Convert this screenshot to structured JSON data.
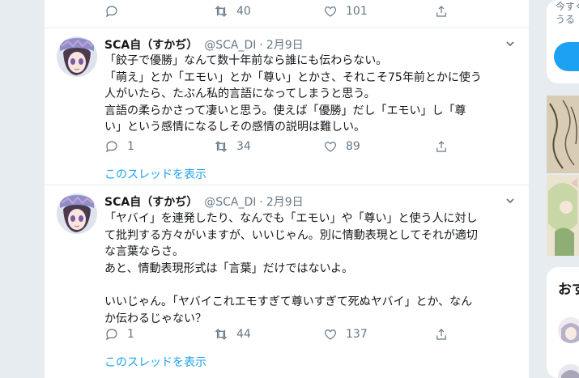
{
  "top_tweet": {
    "reply_count": "",
    "retweet_count": "40",
    "like_count": "101"
  },
  "tweets": [
    {
      "display_name": "SCA自（すかぢ）",
      "handle": "@SCA_DI",
      "separator": "·",
      "date": "2月9日",
      "lines": [
        "「餃子で優勝」なんて数十年前なら誰にも伝わらない。",
        "「萌え」とか「エモい」とか「尊い」とかさ、それこそ75年前とかに使う",
        "人がいたら、たぶん私的言語になってしまうと思う。",
        "言語の柔らかさって凄いと思う。使えば「優勝」だし「エモい」し「尊",
        "い」という感情になるしその感情の説明は難しい。"
      ],
      "reply_count": "1",
      "retweet_count": "34",
      "like_count": "89",
      "thread_link": "このスレッドを表示"
    },
    {
      "display_name": "SCA自（すかぢ）",
      "handle": "@SCA_DI",
      "separator": "·",
      "date": "2月9日",
      "lines": [
        "「ヤバイ」を連発したり、なんでも「エモい」や「尊い」と使う人に対し",
        "て批判する方々がいますが、いいじゃん。別に情動表現としてそれが適切",
        "な言葉ならさ。",
        "あと、情動表現形式は「言葉」だけではないよ。",
        "",
        "いいじゃん。「ヤバイこれエモすぎて尊いすぎて死ぬヤバイ」とか、なん",
        "か伝わるじゃない？"
      ],
      "reply_count": "1",
      "retweet_count": "44",
      "like_count": "137",
      "thread_link": "このスレッドを表示"
    }
  ],
  "sidebar": {
    "trend_lines": [
      "今すぐ",
      "うる"
    ],
    "recommend_title": "おす"
  },
  "icons": {
    "reply": "reply-icon",
    "retweet": "retweet-icon",
    "like": "heart-icon",
    "share": "share-icon",
    "more": "chevron-down-icon"
  },
  "colors": {
    "accent": "#1da1f2",
    "muted": "#657786",
    "text": "#14171a",
    "border": "#e6ecf0"
  }
}
